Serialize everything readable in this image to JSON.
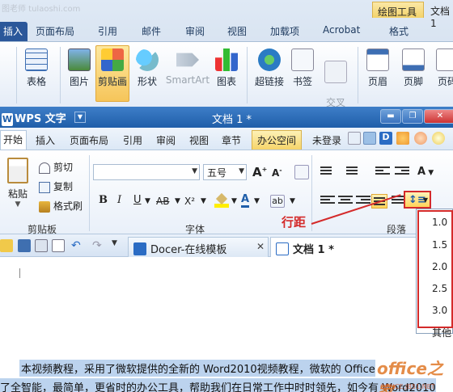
{
  "watermark_top": "图老师 tulaoshi.com",
  "word": {
    "context_tabs": [
      "绘图工具",
      "文档 1"
    ],
    "tabs": [
      "插入",
      "页面布局",
      "引用",
      "邮件",
      "审阅",
      "视图",
      "加载项",
      "Acrobat",
      "格式"
    ],
    "ribbon_buttons": [
      "表格",
      "图片",
      "剪贴画",
      "形状",
      "SmartArt",
      "图表",
      "超链接",
      "书签",
      "交叉\n引用",
      "页眉",
      "页脚",
      "页码"
    ]
  },
  "wps": {
    "logo": "WPS 文字",
    "title": "文档 1 *",
    "tabs": [
      "开始",
      "插入",
      "页面布局",
      "引用",
      "审阅",
      "视图",
      "章节",
      "办公空间"
    ],
    "login": "未登录",
    "clipboard": {
      "paste": "粘贴",
      "cut": "剪切",
      "copy": "复制",
      "format_painter": "格式刷",
      "group_label": "剪贴板"
    },
    "font": {
      "size": "五号",
      "group_label": "字体",
      "bold": "B",
      "italic": "I",
      "underline": "U",
      "strike": "AB",
      "superscript": "X²",
      "color": "A"
    },
    "paragraph": {
      "group_label": "段落"
    },
    "line_spacing_menu": [
      "1.0",
      "1.5",
      "2.0",
      "2.5",
      "3.0"
    ],
    "line_spacing_more": "其他",
    "doc_tabs": [
      "Docer-在线模板",
      "文档 1 *"
    ]
  },
  "annotation": "行距",
  "document": {
    "line1": "本视频教程，采用了微软提供的全新的 Word2010视频教程，微软的 Office",
    "line2": "了全智能，最简单，更省时的办公工具，帮助我们在日常工作中时时领先，如今有 Word2010"
  },
  "watermark_logo": {
    "main": "office之家",
    "sub": "OFFICE.JB51.NET"
  }
}
